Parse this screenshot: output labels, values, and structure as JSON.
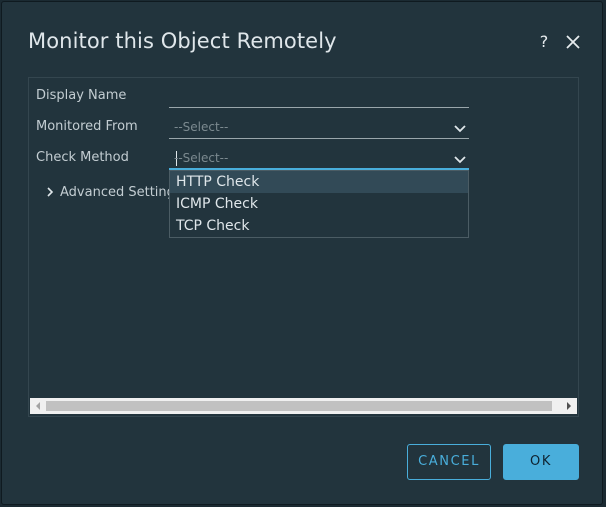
{
  "dialog": {
    "title": "Monitor this Object Remotely",
    "help_label": "?",
    "close_icon": "close-icon",
    "help_icon": "help-icon"
  },
  "form": {
    "display_name": {
      "label": "Display Name",
      "value": ""
    },
    "monitored_from": {
      "label": "Monitored From",
      "placeholder": "--Select--"
    },
    "check_method": {
      "label": "Check Method",
      "placeholder": "--Select--",
      "options": [
        "HTTP Check",
        "ICMP Check",
        "TCP Check"
      ],
      "highlighted_option": "HTTP Check"
    },
    "advanced_settings": {
      "label": "Advanced Settings",
      "expanded": false
    }
  },
  "buttons": {
    "cancel_label": "CANCEL",
    "ok_label": "OK"
  },
  "colors": {
    "background": "#22343d",
    "accent": "#49aedb",
    "text": "#dfe6ea"
  }
}
